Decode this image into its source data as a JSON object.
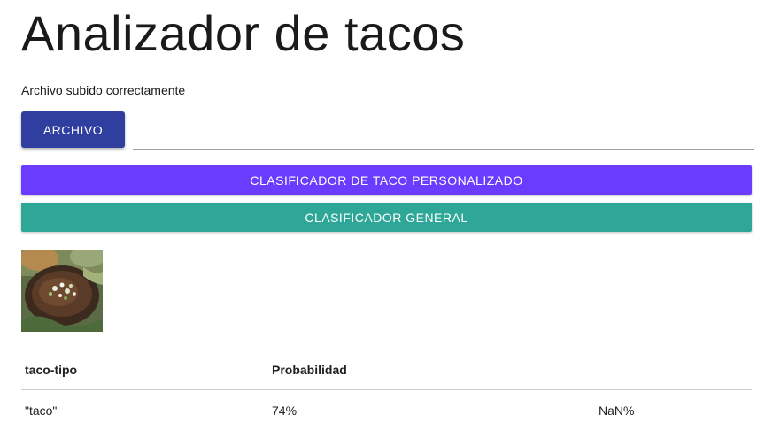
{
  "page": {
    "title": "Analizador de tacos",
    "status_message": "Archivo subido correctamente"
  },
  "upload": {
    "file_button_label": "ARCHIVO",
    "file_field_value": ""
  },
  "actions": {
    "custom_classifier_label": "CLASIFICADOR DE TACO PERSONALIZADO",
    "general_classifier_label": "CLASIFICADOR GENERAL"
  },
  "preview": {
    "image_alt": "taco"
  },
  "results": {
    "columns": [
      "taco-tipo",
      "Probabilidad",
      ""
    ],
    "rows": [
      {
        "type": "\"taco\"",
        "probability": "74%",
        "extra": "NaN%"
      }
    ]
  },
  "colors": {
    "file_button": "#303f9f",
    "custom_classifier": "#6a3cff",
    "general_classifier": "#2ea798"
  }
}
